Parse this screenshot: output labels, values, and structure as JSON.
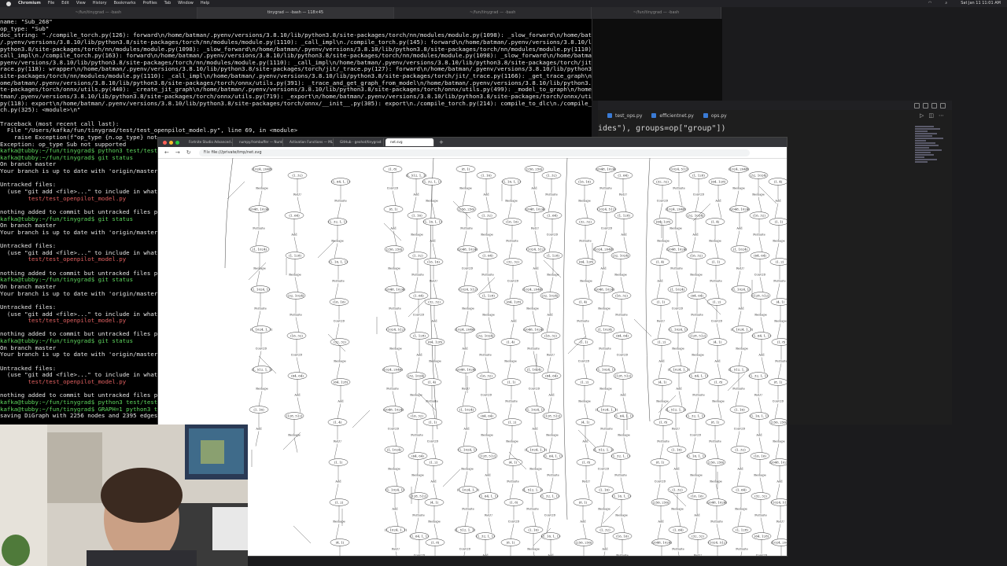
{
  "menubar": {
    "app": "Chromium",
    "items": [
      "File",
      "Edit",
      "View",
      "History",
      "Bookmarks",
      "Profiles",
      "Tab",
      "Window",
      "Help"
    ],
    "clock": "Sat Jan 11 11:01 AM"
  },
  "terminal": {
    "tabs": [
      "~/fun/tinygrad — -bash",
      "tinygrad — -bash — 118×45",
      "~/fun/tinygrad — -bash",
      "~/fun/tinygrad — -bash"
    ],
    "lines": [
      {
        "t": "name: \"Sub_268\"",
        "c": ""
      },
      {
        "t": "op_type: \"Sub\"",
        "c": ""
      },
      {
        "t": "doc_string: \"./compile_torch.py(126): forward\\n/home/batman/.pyenv/versions/3.8.10/lib/python3.8/site-packages/torch/nn/modules/module.py(1098): _slow_forward\\n/home/batman",
        "c": ""
      },
      {
        "t": "/.pyenv/versions/3.8.10/lib/python3.8/site-packages/torch/nn/modules/module.py(1110): _call_impl\\n./compile_torch.py(145): forward\\n/home/batman/.pyenv/versions/3.8.10/lib/",
        "c": ""
      },
      {
        "t": "python3.8/site-packages/torch/nn/modules/module.py(1098): _slow_forward\\n/home/batman/.pyenv/versions/3.8.10/lib/python3.8/site-packages/torch/nn/modules/module.py(1110): _",
        "c": ""
      },
      {
        "t": "call_impl\\n./compile_torch.py(163): forward\\n/home/batman/.pyenv/versions/3.8.10/lib/python3.8/site-packages/torch/nn/modules/module.py(1098): _slow_forward\\n/home/batman/.",
        "c": ""
      },
      {
        "t": "pyenv/versions/3.8.10/lib/python3.8/site-packages/torch/nn/modules/module.py(1110): _call_impl\\n/home/batman/.pyenv/versions/3.8.10/lib/python3.8/site-packages/torch/jit/_t",
        "c": ""
      },
      {
        "t": "race.py(118): wrapper\\n/home/batman/.pyenv/versions/3.8.10/lib/python3.8/site-packages/torch/jit/_trace.py(127): forward\\n/home/batman/.pyenv/versions/3.8.10/lib/python3.8/",
        "c": ""
      },
      {
        "t": "site-packages/torch/nn/modules/module.py(1110): _call_impl\\n/home/batman/.pyenv/versions/3.8.10/lib/python3.8/site-packages/torch/jit/_trace.py(1166): _get_trace_graph\\n/h",
        "c": ""
      },
      {
        "t": "ome/batman/.pyenv/versions/3.8.10/lib/python3.8/site-packages/torch/onnx/utils.py(391): _trace_and_get_graph_from_model\\n/home/batman/.pyenv/versions/3.8.10/lib/python3.8/si",
        "c": ""
      },
      {
        "t": "te-packages/torch/onnx/utils.py(440): _create_jit_graph\\n/home/batman/.pyenv/versions/3.8.10/lib/python3.8/site-packages/torch/onnx/utils.py(499): _model_to_graph\\n/home/ba",
        "c": ""
      },
      {
        "t": "tman/.pyenv/versions/3.8.10/lib/python3.8/site-packages/torch/onnx/utils.py(719): _export\\n/home/batman/.pyenv/versions/3.8.10/lib/python3.8/site-packages/torch/onnx/utils.",
        "c": ""
      },
      {
        "t": "py(118): export\\n/home/batman/.pyenv/versions/3.8.10/lib/python3.8/site-packages/torch/onnx/__init__.py(305): export\\n./compile_torch.py(214): compile_to_dlc\\n./compile_tor",
        "c": ""
      },
      {
        "t": "ch.py(325): <module>\\n\"",
        "c": ""
      },
      {
        "t": "",
        "c": ""
      },
      {
        "t": "Traceback (most recent call last):",
        "c": ""
      },
      {
        "t": "  File \"/Users/kafka/fun/tinygrad/test/test_openpilot_model.py\", line 69, in <module>",
        "c": ""
      },
      {
        "t": "    raise Exception(f\"op_type {n.op_type} not",
        "c": ""
      },
      {
        "t": "Exception: op_type Sub not supported",
        "c": ""
      },
      {
        "t": "kafka@tubby:~/fun/tinygrad$ python3 test/test_",
        "c": "p"
      },
      {
        "t": "kafka@tubby:~/fun/tinygrad$ git status",
        "c": "p"
      },
      {
        "t": "On branch master",
        "c": ""
      },
      {
        "t": "Your branch is up to date with 'origin/master'",
        "c": ""
      },
      {
        "t": "",
        "c": ""
      },
      {
        "t": "Untracked files:",
        "c": ""
      },
      {
        "t": "  (use \"git add <file>...\" to include in what",
        "c": ""
      },
      {
        "t": "        test/test_openpilot_model.py",
        "c": "r"
      },
      {
        "t": "",
        "c": ""
      },
      {
        "t": "nothing added to commit but untracked files p",
        "c": ""
      },
      {
        "t": "kafka@tubby:~/fun/tinygrad$ git status",
        "c": "p"
      },
      {
        "t": "On branch master",
        "c": ""
      },
      {
        "t": "Your branch is up to date with 'origin/master'",
        "c": ""
      },
      {
        "t": "",
        "c": ""
      },
      {
        "t": "Untracked files:",
        "c": ""
      },
      {
        "t": "  (use \"git add <file>...\" to include in what",
        "c": ""
      },
      {
        "t": "        test/test_openpilot_model.py",
        "c": "r"
      },
      {
        "t": "",
        "c": ""
      },
      {
        "t": "nothing added to commit but untracked files p",
        "c": ""
      },
      {
        "t": "kafka@tubby:~/fun/tinygrad$ git status",
        "c": "p"
      },
      {
        "t": "On branch master",
        "c": ""
      },
      {
        "t": "Your branch is up to date with 'origin/master'",
        "c": ""
      },
      {
        "t": "",
        "c": ""
      },
      {
        "t": "Untracked files:",
        "c": ""
      },
      {
        "t": "  (use \"git add <file>...\" to include in what",
        "c": ""
      },
      {
        "t": "        test/test_openpilot_model.py",
        "c": "r"
      },
      {
        "t": "",
        "c": ""
      },
      {
        "t": "nothing added to commit but untracked files p",
        "c": ""
      },
      {
        "t": "kafka@tubby:~/fun/tinygrad$ git status",
        "c": "p"
      },
      {
        "t": "On branch master",
        "c": ""
      },
      {
        "t": "Your branch is up to date with 'origin/master'",
        "c": ""
      },
      {
        "t": "",
        "c": ""
      },
      {
        "t": "Untracked files:",
        "c": ""
      },
      {
        "t": "  (use \"git add <file>...\" to include in what",
        "c": ""
      },
      {
        "t": "        test/test_openpilot_model.py",
        "c": "r"
      },
      {
        "t": "",
        "c": ""
      },
      {
        "t": "nothing added to commit but untracked files p",
        "c": ""
      },
      {
        "t": "kafka@tubby:~/fun/tinygrad$ python3 test/test_",
        "c": "p"
      },
      {
        "t": "kafka@tubby:~/fun/tinygrad$ GRAPH=1 python3 te",
        "c": "p"
      },
      {
        "t": "saving DiGraph with 2256 nodes and 2395 edges",
        "c": ""
      }
    ]
  },
  "vscode": {
    "tabs": [
      "test_ops.py",
      "efficientnet.py",
      "ops.py"
    ],
    "code_line": "ides\"), groups=op[\"group\"])"
  },
  "browser": {
    "tabs": [
      "Fortnite Studio Advanced Audi…",
      "numpy.frombuffer — NumPy v…",
      "Activation Functions — ML Gl…",
      "GitHub - geohot/tinygrad: Yo…",
      "net.svg"
    ],
    "active_tab": 4,
    "url": "file:///private/tmp/net.svg",
    "url_prefix": "File"
  },
  "graph": {
    "shapes": [
      "(1024, 2048)",
      "(2048, 1024)",
      "(1, 1024)",
      "(1, 1024, 1)",
      "(1, 1024, 1, 1)",
      "(1, 512, 1, 1)",
      "(1, 16)",
      "(1, 32)",
      "(1, 64)",
      "(1, 128)",
      "(32, 1024)",
      "(16, 32)",
      "(64, 64)",
      "(128, 512)",
      "(1, 64, 1, 1)",
      "(1, 32, 1, 1)",
      "(1, 16, 1, 1)",
      "(16, 16)",
      "(32, 32)",
      "(64, 128)",
      "(1, 4)",
      "(1, 1)",
      "(1, 2)",
      "(4, 1)",
      "(1, 8)",
      "(8, 1)",
      "(256, 256)",
      "(2048, 1024)",
      "(1024, 512)"
    ],
    "ops": [
      "Reshape",
      "Permute",
      "Reshape",
      "Permute",
      "Conv2D",
      "Reshape",
      "Add",
      "ReLU",
      "Add",
      "Reshape",
      "Permute",
      "Conv2D",
      "Add"
    ]
  }
}
